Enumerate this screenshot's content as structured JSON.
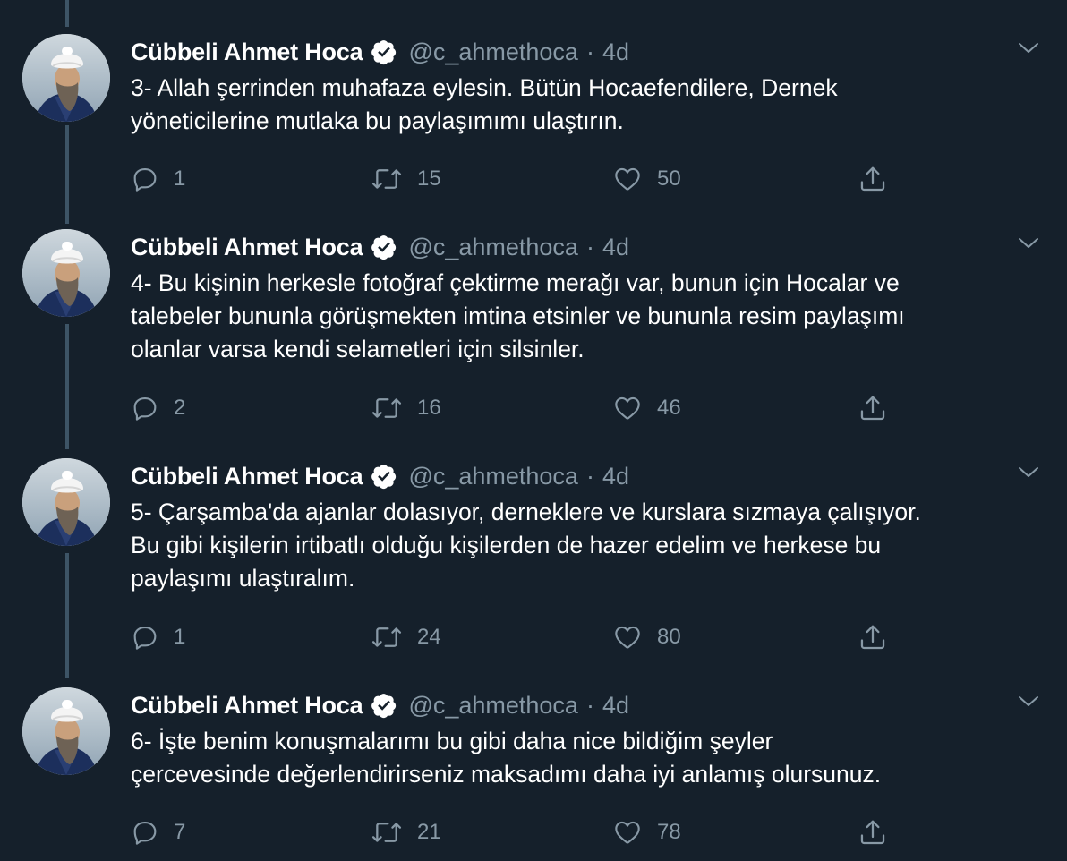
{
  "tweets": [
    {
      "author": "Cübbeli Ahmet Hoca",
      "handle": "@c_ahmethoca",
      "separator": "·",
      "time": "4d",
      "text": "3- Allah şerrinden muhafaza eylesin. Bütün Hocaefendilere, Dernek\nyöneticilerine mutlaka bu paylaşımımı ulaştırın.",
      "replies": "1",
      "retweets": "15",
      "likes": "50"
    },
    {
      "author": "Cübbeli Ahmet Hoca",
      "handle": "@c_ahmethoca",
      "separator": "·",
      "time": "4d",
      "text": "4- Bu kişinin herkesle fotoğraf çektirme merağı var, bunun için Hocalar ve\ntalebeler bununla görüşmekten imtina etsinler ve bununla resim paylaşımı\nolanlar varsa kendi selametleri için silsinler.",
      "replies": "2",
      "retweets": "16",
      "likes": "46"
    },
    {
      "author": "Cübbeli Ahmet Hoca",
      "handle": "@c_ahmethoca",
      "separator": "·",
      "time": "4d",
      "text": "5- Çarşamba'da ajanlar dolasıyor, derneklere ve kurslara sızmaya çalışıyor.\nBu gibi kişilerin irtibatlı olduğu kişilerden de hazer edelim ve herkese bu\npaylaşımı ulaştıralım.",
      "replies": "1",
      "retweets": "24",
      "likes": "80"
    },
    {
      "author": "Cübbeli Ahmet Hoca",
      "handle": "@c_ahmethoca",
      "separator": "·",
      "time": "4d",
      "text": "6- İşte benim konuşmalarımı bu gibi daha nice bildiğim şeyler\nçercevesinde değerlendirirseniz maksadımı daha iyi anlamış olursunuz.",
      "replies": "7",
      "retweets": "21",
      "likes": "78"
    }
  ],
  "icons": {
    "reply": "reply-icon",
    "retweet": "retweet-icon",
    "like": "heart-icon",
    "share": "share-icon",
    "verified": "verified-badge-icon",
    "more": "chevron-down-icon"
  },
  "colors": {
    "background": "#15202b",
    "primary_text": "#ffffff",
    "secondary_text": "#8899a6",
    "thread_line": "#3d5466"
  }
}
